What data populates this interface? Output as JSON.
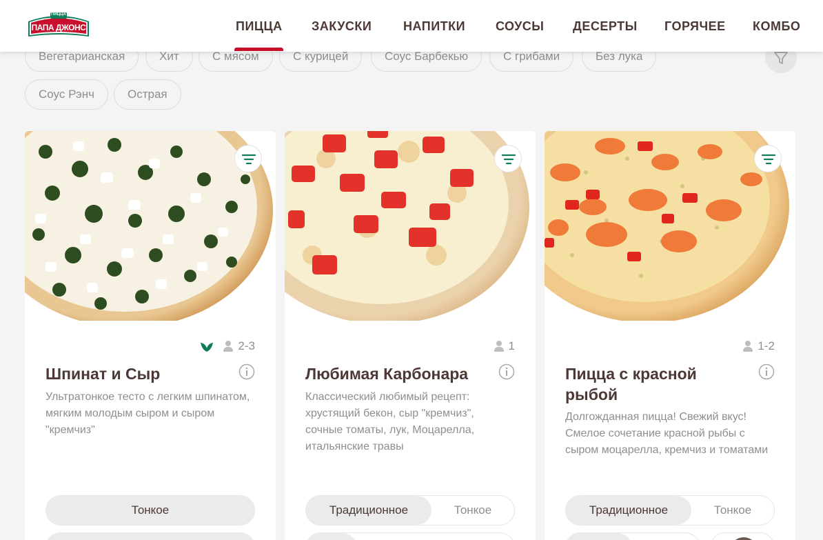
{
  "brand": {
    "logo_top": "ПИЦЦА",
    "logo_main": "ПАПА ДЖОНС",
    "primary": "#c8102e",
    "green": "#0f7c5b",
    "text": "#4c3935"
  },
  "nav": {
    "items": [
      {
        "label": "ПИЦЦА"
      },
      {
        "label": "ЗАКУСКИ"
      },
      {
        "label": "НАПИТКИ"
      },
      {
        "label": "СОУСЫ"
      },
      {
        "label": "ДЕСЕРТЫ"
      },
      {
        "label": "ГОРЯЧЕЕ"
      },
      {
        "label": "КОМБО"
      }
    ],
    "active": "ПИЦЦА"
  },
  "filters": {
    "chips": [
      {
        "label": "Вегетарианская"
      },
      {
        "label": "Хит"
      },
      {
        "label": "С мясом"
      },
      {
        "label": "С курицей"
      },
      {
        "label": "Соус Барбекью"
      },
      {
        "label": "С грибами"
      },
      {
        "label": "Без лука"
      },
      {
        "label": "Соус Рэнч"
      },
      {
        "label": "Острая"
      }
    ],
    "filter_icon": "funnel-icon"
  },
  "products": [
    {
      "title": "Шпинат и Сыр",
      "persons": "2-3",
      "vegetarian": true,
      "description": "Ультратонкое тесто с легким шпинатом, мягким молодым сыром и сыром \"кремчиз\"",
      "dough_options": [
        "Тонкое"
      ],
      "dough_selected": "Тонкое"
    },
    {
      "title": "Любимая Карбонара",
      "persons": "1",
      "vegetarian": false,
      "description": "Классический любимый рецепт: хрустящий бекон, сыр \"кремчиз\", сочные томаты, лук, Моцарелла, итальянские травы",
      "dough_options": [
        "Традиционное",
        "Тонкое"
      ],
      "dough_selected": "Традиционное"
    },
    {
      "title": "Пицца с красной рыбой",
      "persons": "1-2",
      "vegetarian": false,
      "description": "Долгожданная пицца! Свежий вкус! Смелое сочетание красной рыбы с сыром моцарелла, кремчиз и томатами",
      "dough_options": [
        "Традиционное",
        "Тонкое"
      ],
      "dough_selected": "Традиционное"
    }
  ]
}
